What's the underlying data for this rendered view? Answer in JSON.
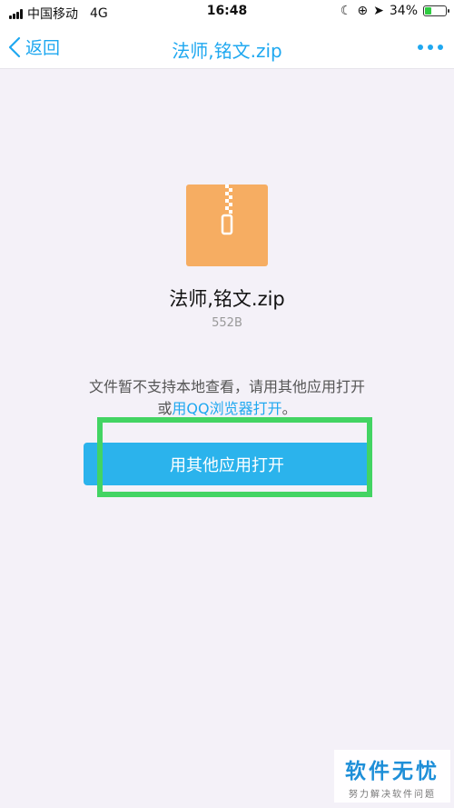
{
  "status_bar": {
    "carrier": "中国移动",
    "network": "4G",
    "time": "16:48",
    "battery": "34%",
    "battery_level": 0.34
  },
  "nav": {
    "back_label": "返回",
    "title": "法师,铭文.zip"
  },
  "file": {
    "name": "法师,铭文.zip",
    "size": "552B",
    "icon": "zip-archive-icon",
    "icon_color": "#f6ad62"
  },
  "hint": {
    "line1": "文件暂不支持本地查看，请用其他应用打开",
    "line2_prefix": "或",
    "line2_link": "用QQ浏览器打开",
    "line2_suffix": "。"
  },
  "open_button": {
    "label": "用其他应用打开"
  },
  "colors": {
    "accent": "#1fa8f0",
    "button": "#2bb3ec",
    "highlight": "#43d463"
  },
  "watermark": {
    "title": "软件无忧",
    "subtitle": "努力解决软件问题"
  }
}
